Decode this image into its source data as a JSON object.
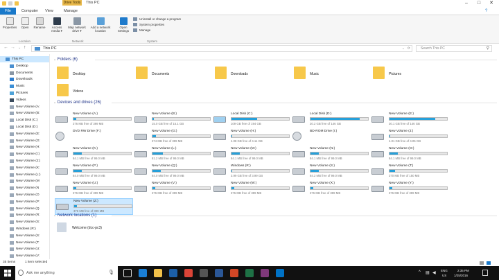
{
  "window": {
    "title": "This PC",
    "contextual_tab": "Drive Tools",
    "accent": "#1979ca",
    "controls": [
      "–",
      "□",
      "✕"
    ]
  },
  "tabs": [
    "File",
    "Computer",
    "View",
    "Manage"
  ],
  "ribbon": {
    "location": {
      "group": "Location",
      "buttons": [
        "Properties",
        "Open",
        "Rename"
      ]
    },
    "network": {
      "group": "Network",
      "buttons": [
        "Access media ▾",
        "Map network drive ▾",
        "Add a network location"
      ]
    },
    "system": {
      "group": "System",
      "open_settings": "Open Settings",
      "small": [
        "Uninstall or change a program",
        "System properties",
        "Manage"
      ]
    }
  },
  "address": {
    "path": "This PC",
    "search_placeholder": "Search This PC"
  },
  "nav": [
    {
      "label": "This PC",
      "selected": true,
      "level": 0
    },
    {
      "label": "Desktop"
    },
    {
      "label": "Documents"
    },
    {
      "label": "Downloads"
    },
    {
      "label": "Music"
    },
    {
      "label": "Pictures"
    },
    {
      "label": "Videos"
    },
    {
      "label": "New Volume (A:"
    },
    {
      "label": "New Volume (B:"
    },
    {
      "label": "Local Disk (C:)"
    },
    {
      "label": "Local Disk (D:)"
    },
    {
      "label": "New Volume (E:"
    },
    {
      "label": "New Volume (G:"
    },
    {
      "label": "New Volume (H:"
    },
    {
      "label": "New Volume (I:)"
    },
    {
      "label": "New Volume (J:)"
    },
    {
      "label": "New Volume (K:"
    },
    {
      "label": "New Volume (L:)"
    },
    {
      "label": "New Volume (M"
    },
    {
      "label": "New Volume (N"
    },
    {
      "label": "New Volume (O"
    },
    {
      "label": "New Volume (P:"
    },
    {
      "label": "New Volume (Q"
    },
    {
      "label": "New Volume (R:"
    },
    {
      "label": "New Volume (S:"
    },
    {
      "label": "Windows (R:)"
    },
    {
      "label": "New Volume (S:"
    },
    {
      "label": "New Volume (T:"
    },
    {
      "label": "New Volume (U:"
    },
    {
      "label": "New Volume (V:"
    }
  ],
  "folders_header": "Folders (6)",
  "folders": [
    "Desktop",
    "Documents",
    "Downloads",
    "Music",
    "Pictures",
    "Videos"
  ],
  "drives_header": "Devices and drives (26)",
  "drives": [
    {
      "name": "New Volume (A:)",
      "free": "376 MB free of 399 MB",
      "used": 0.05
    },
    {
      "name": "New Volume (B:)",
      "free": "15.0 GB free of 15.1 GB",
      "used": 0.02
    },
    {
      "name": "Local Disk (C:)",
      "free": "109 GB free of 194 GB",
      "used": 0.44
    },
    {
      "name": "Local Disk (D:)",
      "free": "20.2 GB free of 146 GB",
      "used": 0.86
    },
    {
      "name": "New Volume (E:)",
      "free": "30.1 GB free of 146 GB",
      "used": 0.79
    },
    {
      "name": "DVD RW Drive (F:)",
      "free": "",
      "used": null
    },
    {
      "name": "New Volume (G:)",
      "free": "374 MB free of 399 MB",
      "used": 0.06
    },
    {
      "name": "New Volume (H:)",
      "free": "4.08 GB free of 4.11 GB",
      "used": 0.01
    },
    {
      "name": "BD-ROM Drive (I:)",
      "free": "",
      "used": null
    },
    {
      "name": "New Volume (J:)",
      "free": "4.01 GB free of 4.05 GB",
      "used": 0.01
    },
    {
      "name": "New Volume (K:)",
      "free": "84.1 MB free of 99.0 MB",
      "used": 0.15
    },
    {
      "name": "New Volume (L:)",
      "free": "81.2 MB free of 99.0 MB",
      "used": 0.18
    },
    {
      "name": "New Volume (M:)",
      "free": "84.1 MB free of 99.0 MB",
      "used": 0.15
    },
    {
      "name": "New Volume (N:)",
      "free": "84.1 MB free of 99.0 MB",
      "used": 0.15
    },
    {
      "name": "New Volume (O:)",
      "free": "84.1 MB free of 99.0 MB",
      "used": 0.15
    },
    {
      "name": "New Volume (P:)",
      "free": "84.0 MB free of 99.0 MB",
      "used": 0.15
    },
    {
      "name": "New Volume (Q:)",
      "free": "84.0 MB free of 99.0 MB",
      "used": 0.15
    },
    {
      "name": "Windows (R:)",
      "free": "3.99 GB free of 3.99 GB",
      "used": 0.01
    },
    {
      "name": "New Volume (S:)",
      "free": "84.2 MB free of 99.0 MB",
      "used": 0.15
    },
    {
      "name": "New Volume (T:)",
      "free": "370 MB free of 150 MB",
      "used": 0.1
    },
    {
      "name": "New Volume (U:)",
      "free": "376 MB free of 399 MB",
      "used": 0.05
    },
    {
      "name": "New Volume (V:)",
      "free": "376 MB free of 399 MB",
      "used": 0.05
    },
    {
      "name": "New Volume (W:)",
      "free": "376 MB free of 399 MB",
      "used": 0.05
    },
    {
      "name": "New Volume (X:)",
      "free": "376 MB free of 399 MB",
      "used": 0.05
    },
    {
      "name": "New Volume (Y:)",
      "free": "376 MB free of 399 MB",
      "used": 0.05
    },
    {
      "name": "New Volume (Z:)",
      "free": "376 MB free of 399 MB",
      "used": 0.05,
      "selected": true
    }
  ],
  "network_header": "Network locations (1)",
  "network": [
    {
      "name": "Welcome (dcc-pc3)"
    }
  ],
  "status": {
    "items": "35 items",
    "selected": "1 item selected"
  },
  "taskbar": {
    "search_placeholder": "Ask me anything",
    "time": "2:35 PM",
    "date": "1/25/2016",
    "lang": "ENG",
    "region": "US"
  }
}
